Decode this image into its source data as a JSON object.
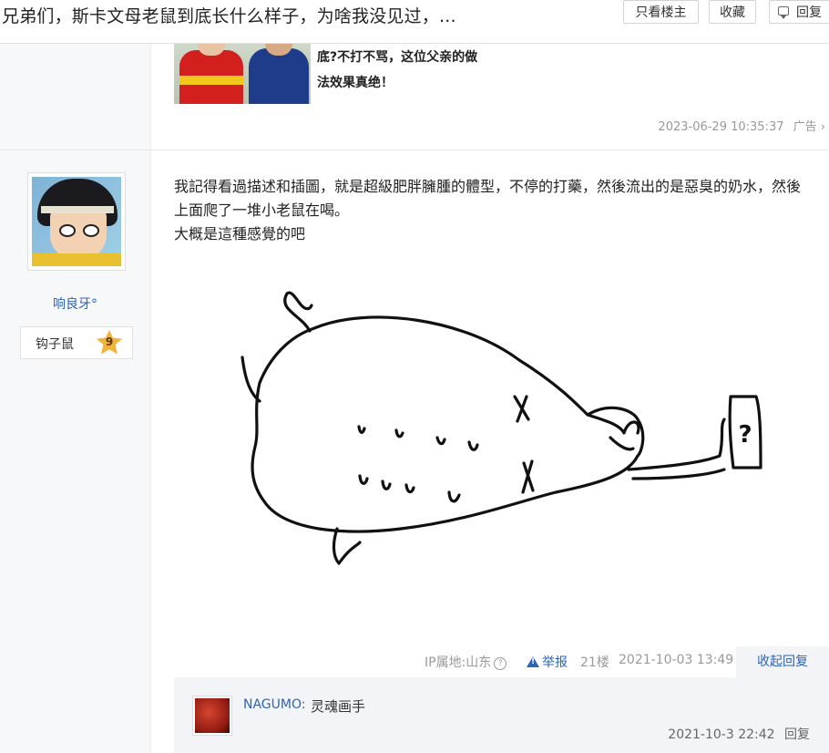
{
  "thread": {
    "title": "兄弟们，斯卡文母老鼠到底长什么样子，为啥我没见过，...",
    "buttons": {
      "only_op": "只看楼主",
      "favorite": "收藏",
      "reply": "回复"
    }
  },
  "ad_post": {
    "text_line1": "底?不打不骂，这位父亲的做",
    "text_line2": "法效果真绝！",
    "time": "2023-06-29 10:35:37",
    "tag": "广告",
    "chevron": "›"
  },
  "post": {
    "author": "响良牙°",
    "level_name": "钩子鼠",
    "level": "9",
    "content_line1": "我記得看過描述和插圖，就是超級肥胖臃腫的體型，不停的打藥，然後流出的是惡臭的奶水，然後上面爬了一堆小老鼠在喝。",
    "content_line2": "大概是這種感覺的吧",
    "sketch_label": "?",
    "ip": "IP属地:山东",
    "help": "?",
    "report": "举报",
    "floor": "21楼",
    "time": "2021-10-03 13:49",
    "collapse": "收起回复"
  },
  "comments": [
    {
      "user": "NAGUMO:",
      "text": "灵魂画手",
      "time": "2021-10-3 22:42",
      "reply": "回复"
    }
  ],
  "colors": {
    "link": "#2d64b3",
    "meta": "#999999",
    "panel": "#f7f8fa",
    "badge": "#f2b33a"
  }
}
